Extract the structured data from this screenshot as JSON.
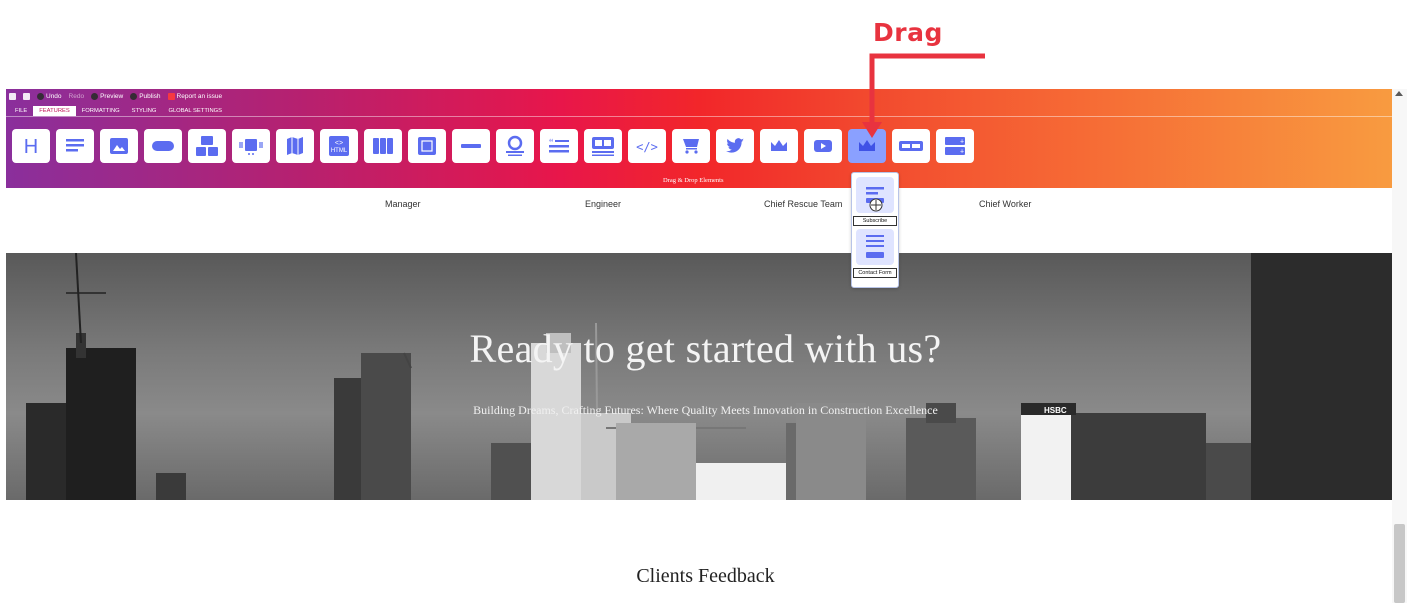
{
  "annotation": {
    "label": "Drag",
    "color": "#e8333f"
  },
  "topbar": {
    "undo": "Undo",
    "redo": "Redo",
    "preview": "Preview",
    "publish": "Publish",
    "report": "Report an issue"
  },
  "tabs": [
    "FILE",
    "FEATURES",
    "FORMATTING",
    "STYLING",
    "GLOBAL SETTINGS"
  ],
  "active_tab": "FEATURES",
  "tools": [
    "heading-icon",
    "paragraph-icon",
    "image-icon",
    "button-icon",
    "gallery-icon",
    "slider-icon",
    "map-icon",
    "html-icon",
    "columns-icon",
    "box-icon",
    "divider-icon",
    "team-icon",
    "quote-icon",
    "card-icon",
    "code-icon",
    "cart-icon",
    "twitter-icon",
    "crown-icon",
    "youtube-icon",
    "crown-icon",
    "two-buttons-icon",
    "form-icon"
  ],
  "tool_html_text": "HTML",
  "tool_heading_text": "H",
  "dnd_label": "Drag & Drop Elements",
  "team": [
    "Manager",
    "Engineer",
    "Chief Rescue Team",
    "Chief Worker"
  ],
  "dropdown": {
    "items": [
      "Subscribe",
      "Contact Form"
    ]
  },
  "hero": {
    "title": "Ready to get started with us?",
    "subtitle": "Building Dreams, Crafting Futures: Where Quality Meets Innovation in Construction Excellence",
    "sign": "HSBC"
  },
  "clients_title": "Clients Feedback",
  "colors": {
    "accent": "#e8333f",
    "tool_highlight": "#8aa0ff"
  }
}
